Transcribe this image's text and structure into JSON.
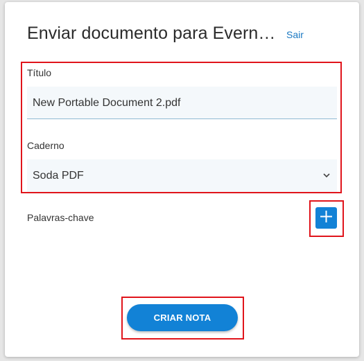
{
  "dialog": {
    "title": "Enviar documento para Evern…",
    "exit_label": "Sair"
  },
  "fields": {
    "title_label": "Título",
    "title_value": "New Portable Document 2.pdf",
    "notebook_label": "Caderno",
    "notebook_value": "Soda PDF",
    "tags_label": "Palavras-chave"
  },
  "actions": {
    "create_label": "CRIAR NOTA"
  },
  "icons": {
    "add": "plus-icon",
    "dropdown": "chevron-down-icon"
  },
  "colors": {
    "accent": "#1282d6",
    "highlight": "#e0141b",
    "link": "#1a78c2"
  }
}
